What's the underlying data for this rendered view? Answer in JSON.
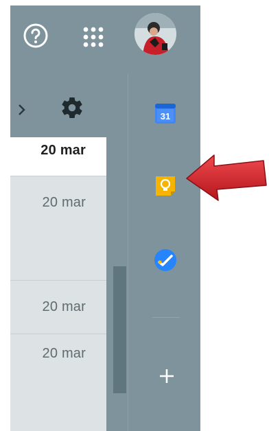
{
  "header": {
    "help_icon": "help-circle-icon",
    "apps_icon": "apps-grid-icon",
    "avatar": "account-avatar"
  },
  "toolbar": {
    "next_icon": "chevron-right-icon",
    "settings_icon": "gear-icon"
  },
  "list": {
    "rows": [
      {
        "date": "20 mar",
        "unread": true
      },
      {
        "date": "20 mar",
        "unread": false
      },
      {
        "date": "20 mar",
        "unread": false
      },
      {
        "date": "20 mar",
        "unread": false
      }
    ]
  },
  "side_panel": {
    "calendar": {
      "icon": "google-calendar-icon",
      "day": "31"
    },
    "keep": {
      "icon": "google-keep-icon"
    },
    "tasks": {
      "icon": "google-tasks-icon"
    },
    "add": {
      "icon": "plus-icon"
    }
  },
  "annotation": {
    "icon": "red-arrow-icon",
    "color": "#d9262c"
  },
  "colors": {
    "panel_bg": "#7e939b",
    "list_bg": "#dde2e4",
    "selected_row_bg": "#ffffff",
    "calendar_blue": "#4285f4",
    "keep_yellow": "#f6b400",
    "tasks_blue": "#2684fc"
  }
}
